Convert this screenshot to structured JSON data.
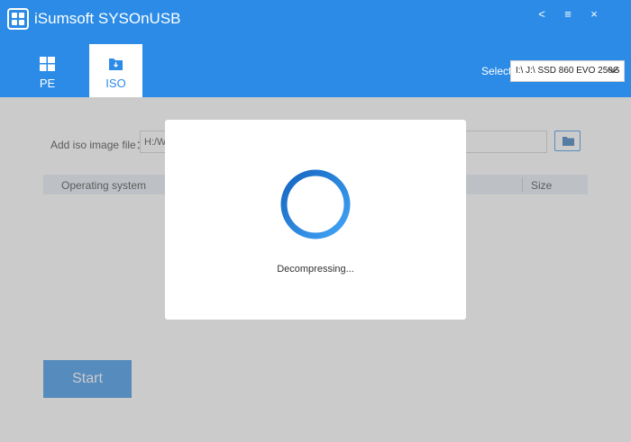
{
  "app": {
    "title": "iSumsoft SYSOnUSB"
  },
  "window_controls": {
    "back": "<",
    "menu": "≡",
    "close": "×"
  },
  "tabs": [
    {
      "label": "PE",
      "icon": "windows-icon",
      "active": false
    },
    {
      "label": "ISO",
      "icon": "iso-download-icon",
      "active": true
    }
  ],
  "select": {
    "label": "Select:",
    "value": "I:\\ J:\\ SSD 860 EVO 250G"
  },
  "iso": {
    "label": "Add iso image file：",
    "path": "H:/W"
  },
  "table": {
    "columns": [
      "Operating system",
      "Size"
    ]
  },
  "start": {
    "label": "Start"
  },
  "dialog": {
    "message": "Decompressing..."
  },
  "colors": {
    "brand": "#2b8be6",
    "overlay": "#c8c8c8",
    "table_header": "#e6edf5"
  }
}
